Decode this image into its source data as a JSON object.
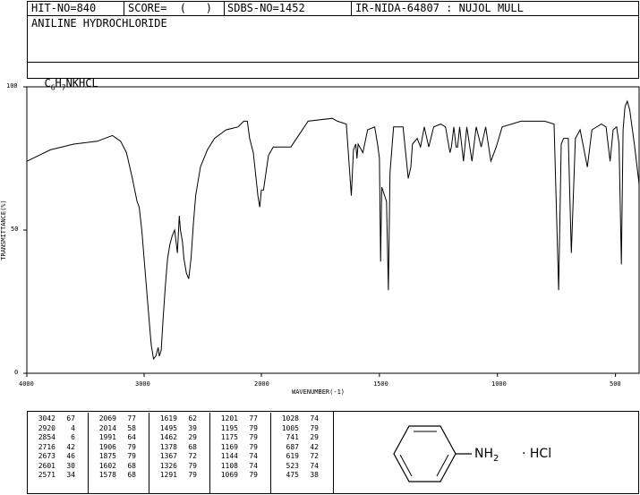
{
  "header": {
    "hit_no": "HIT-NO=840",
    "score": "SCORE=  (   )",
    "sdbs_no": "SDBS-NO=1452",
    "ir_nida": "IR-NIDA-64807 : NUJOL MULL",
    "compound_name": "ANILINE HYDROCHLORIDE",
    "formula": {
      "c": "C",
      "c_sub": "6",
      "h": "H",
      "h_sub": "7",
      "rest": "NKHCL"
    }
  },
  "chart_data": {
    "type": "line",
    "xlabel": "WAVENUMBER(-1)",
    "ylabel": "TRANSMITTANCE(%)",
    "xlim": [
      4000,
      400
    ],
    "ylim": [
      0,
      100
    ],
    "x_ticks": [
      "4000",
      "3000",
      "2000",
      "1500",
      "1000",
      "500"
    ],
    "y_ticks": [
      "100",
      "50",
      "0"
    ],
    "grid": false,
    "series": [
      {
        "points": [
          [
            4000,
            74
          ],
          [
            3800,
            78
          ],
          [
            3600,
            80
          ],
          [
            3400,
            81
          ],
          [
            3270,
            83
          ],
          [
            3200,
            81
          ],
          [
            3150,
            77
          ],
          [
            3100,
            68
          ],
          [
            3060,
            60
          ],
          [
            3042,
            58
          ],
          [
            3020,
            50
          ],
          [
            3000,
            40
          ],
          [
            2970,
            25
          ],
          [
            2940,
            10
          ],
          [
            2920,
            5
          ],
          [
            2900,
            6
          ],
          [
            2880,
            9
          ],
          [
            2870,
            6
          ],
          [
            2854,
            8
          ],
          [
            2840,
            18
          ],
          [
            2820,
            30
          ],
          [
            2800,
            40
          ],
          [
            2780,
            45
          ],
          [
            2760,
            48
          ],
          [
            2740,
            50
          ],
          [
            2716,
            42
          ],
          [
            2700,
            55
          ],
          [
            2690,
            50
          ],
          [
            2673,
            46
          ],
          [
            2660,
            40
          ],
          [
            2640,
            35
          ],
          [
            2620,
            33
          ],
          [
            2600,
            40
          ],
          [
            2580,
            52
          ],
          [
            2560,
            62
          ],
          [
            2520,
            72
          ],
          [
            2460,
            78
          ],
          [
            2400,
            82
          ],
          [
            2300,
            85
          ],
          [
            2200,
            86
          ],
          [
            2150,
            88
          ],
          [
            2120,
            88
          ],
          [
            2100,
            82
          ],
          [
            2069,
            77
          ],
          [
            2050,
            70
          ],
          [
            2030,
            62
          ],
          [
            2014,
            58
          ],
          [
            2000,
            64
          ],
          [
            1991,
            64
          ],
          [
            1970,
            76
          ],
          [
            1950,
            79
          ],
          [
            1906,
            79
          ],
          [
            1875,
            79
          ],
          [
            1802,
            88
          ],
          [
            1700,
            89
          ],
          [
            1678,
            88
          ],
          [
            1640,
            87
          ],
          [
            1619,
            62
          ],
          [
            1610,
            78
          ],
          [
            1600,
            80
          ],
          [
            1595,
            75
          ],
          [
            1590,
            80
          ],
          [
            1570,
            77
          ],
          [
            1550,
            85
          ],
          [
            1520,
            86
          ],
          [
            1508,
            80
          ],
          [
            1500,
            75
          ],
          [
            1495,
            39
          ],
          [
            1490,
            65
          ],
          [
            1470,
            60
          ],
          [
            1462,
            29
          ],
          [
            1455,
            70
          ],
          [
            1440,
            86
          ],
          [
            1420,
            86
          ],
          [
            1400,
            86
          ],
          [
            1378,
            68
          ],
          [
            1367,
            72
          ],
          [
            1360,
            80
          ],
          [
            1340,
            82
          ],
          [
            1326,
            79
          ],
          [
            1310,
            86
          ],
          [
            1291,
            79
          ],
          [
            1270,
            86
          ],
          [
            1240,
            87
          ],
          [
            1220,
            86
          ],
          [
            1201,
            77
          ],
          [
            1195,
            79
          ],
          [
            1185,
            86
          ],
          [
            1175,
            79
          ],
          [
            1169,
            79
          ],
          [
            1160,
            86
          ],
          [
            1144,
            74
          ],
          [
            1130,
            86
          ],
          [
            1108,
            74
          ],
          [
            1090,
            86
          ],
          [
            1069,
            79
          ],
          [
            1050,
            86
          ],
          [
            1028,
            74
          ],
          [
            1005,
            79
          ],
          [
            980,
            86
          ],
          [
            900,
            88
          ],
          [
            800,
            88
          ],
          [
            760,
            87
          ],
          [
            741,
            29
          ],
          [
            730,
            80
          ],
          [
            720,
            82
          ],
          [
            700,
            82
          ],
          [
            687,
            42
          ],
          [
            670,
            82
          ],
          [
            650,
            85
          ],
          [
            619,
            72
          ],
          [
            600,
            85
          ],
          [
            560,
            87
          ],
          [
            540,
            86
          ],
          [
            523,
            74
          ],
          [
            510,
            85
          ],
          [
            495,
            86
          ],
          [
            485,
            80
          ],
          [
            475,
            38
          ],
          [
            468,
            85
          ],
          [
            460,
            93
          ],
          [
            450,
            95
          ],
          [
            440,
            92
          ],
          [
            420,
            80
          ],
          [
            400,
            66
          ]
        ]
      }
    ]
  },
  "peak_table": [
    [
      [
        "3042",
        "67"
      ],
      [
        "2920",
        "4"
      ],
      [
        "2854",
        "6"
      ],
      [
        "2716",
        "42"
      ],
      [
        "2673",
        "46"
      ],
      [
        "2601",
        "30"
      ],
      [
        "2571",
        "34"
      ]
    ],
    [
      [
        "2069",
        "77"
      ],
      [
        "2014",
        "58"
      ],
      [
        "1991",
        "64"
      ],
      [
        "1906",
        "79"
      ],
      [
        "1875",
        "79"
      ],
      [
        "1602",
        "68"
      ],
      [
        "1578",
        "68"
      ]
    ],
    [
      [
        "1619",
        "62"
      ],
      [
        "1495",
        "39"
      ],
      [
        "1462",
        "29"
      ],
      [
        "1378",
        "68"
      ],
      [
        "1367",
        "72"
      ],
      [
        "1326",
        "79"
      ],
      [
        "1291",
        "79"
      ]
    ],
    [
      [
        "1201",
        "77"
      ],
      [
        "1195",
        "79"
      ],
      [
        "1175",
        "79"
      ],
      [
        "1169",
        "79"
      ],
      [
        "1144",
        "74"
      ],
      [
        "1108",
        "74"
      ],
      [
        "1069",
        "79"
      ]
    ],
    [
      [
        "1028",
        "74"
      ],
      [
        "1005",
        "79"
      ],
      [
        "741",
        "29"
      ],
      [
        "687",
        "42"
      ],
      [
        "619",
        "72"
      ],
      [
        "523",
        "74"
      ],
      [
        "475",
        "38"
      ]
    ]
  ],
  "structure": {
    "group_label": "NH",
    "group_sub": "2",
    "salt_label": "· HCl"
  }
}
